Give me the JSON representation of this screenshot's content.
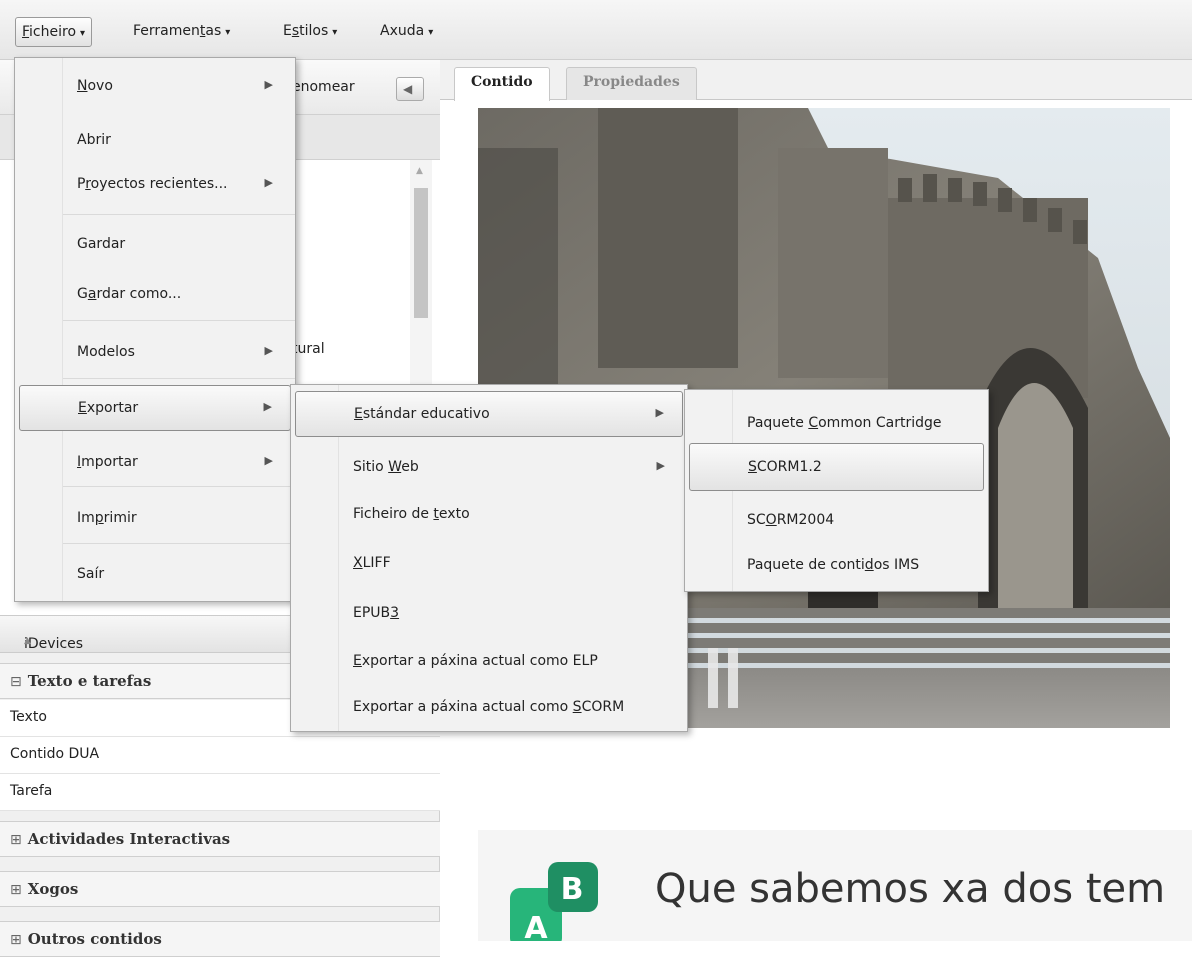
{
  "menubar": {
    "items": [
      {
        "pre": "",
        "key": "F",
        "post": "icheiro"
      },
      {
        "pre": "Ferramen",
        "key": "t",
        "post": "as"
      },
      {
        "pre": "E",
        "key": "s",
        "post": "tilos"
      },
      {
        "pre": "Axuda",
        "key": "",
        "post": ""
      }
    ]
  },
  "nav": {
    "rename_partial": "enomear",
    "tree_partial": "tural"
  },
  "idevices": {
    "header": "iDevices",
    "header_arrow": "▲",
    "categories": [
      {
        "sign": "⊟",
        "label": "Texto e tarefas"
      },
      {
        "sign": "⊞",
        "label": "Actividades Interactivas"
      },
      {
        "sign": "⊞",
        "label": "Xogos"
      },
      {
        "sign": "⊞",
        "label": "Outros contidos"
      }
    ],
    "items": [
      "Texto",
      "Contido DUA",
      "Tarefa"
    ]
  },
  "tabs": [
    {
      "label": "Contido"
    },
    {
      "label": "Propiedades"
    }
  ],
  "banner": {
    "title": "Que sabemos xa dos tem",
    "logo_letters": [
      "A",
      "B"
    ]
  },
  "file_menu": {
    "items": [
      {
        "pre": "",
        "key": "N",
        "post": "ovo",
        "sub": "▶"
      },
      {
        "pre": "Abrir",
        "key": "",
        "post": "",
        "sub": ""
      },
      {
        "pre": "P",
        "key": "r",
        "post": "oyectos recientes...",
        "sub": "▶"
      },
      {
        "pre": "Gardar",
        "key": "",
        "post": "",
        "sub": ""
      },
      {
        "pre": "G",
        "key": "a",
        "post": "rdar como...",
        "sub": ""
      },
      {
        "pre": "Modelos",
        "key": "",
        "post": "",
        "sub": "▶"
      },
      {
        "pre": "",
        "key": "E",
        "post": "xportar",
        "sub": "▶"
      },
      {
        "pre": "",
        "key": "I",
        "post": "mportar",
        "sub": "▶"
      },
      {
        "pre": "Im",
        "key": "p",
        "post": "rimir",
        "sub": ""
      },
      {
        "pre": "Saír",
        "key": "",
        "post": "",
        "sub": ""
      }
    ]
  },
  "export_menu": {
    "items": [
      {
        "pre": "",
        "key": "E",
        "post": "stándar educativo",
        "sub": "▶"
      },
      {
        "pre": "Sitio ",
        "key": "W",
        "post": "eb",
        "sub": "▶"
      },
      {
        "pre": "Ficheiro de ",
        "key": "t",
        "post": "exto",
        "sub": ""
      },
      {
        "pre": "",
        "key": "X",
        "post": "LIFF",
        "sub": ""
      },
      {
        "pre": "EPUB",
        "key": "3",
        "post": "",
        "sub": ""
      },
      {
        "pre": "",
        "key": "E",
        "post": "xportar a páxina actual como ELP",
        "sub": ""
      },
      {
        "pre": "Exportar a páxina actual como ",
        "key": "S",
        "post": "CORM",
        "sub": ""
      }
    ]
  },
  "standard_menu": {
    "items": [
      {
        "pre": "Paquete ",
        "key": "C",
        "post": "ommon Cartridge"
      },
      {
        "pre": "",
        "key": "S",
        "post": "CORM1.2"
      },
      {
        "pre": "SC",
        "key": "O",
        "post": "RM2004"
      },
      {
        "pre": "Paquete de conti",
        "key": "d",
        "post": "os IMS"
      }
    ]
  },
  "colors": {
    "logo_green": "#27b57a",
    "logo_dark": "#1f8f63"
  }
}
